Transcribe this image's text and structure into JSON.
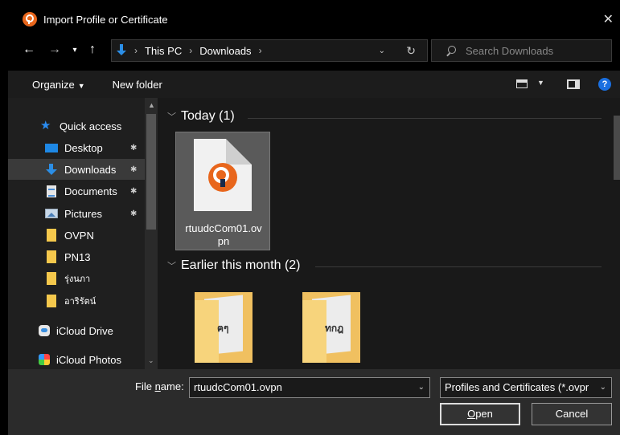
{
  "window": {
    "title": "Import Profile or Certificate",
    "icon": "openvpn-icon",
    "close_glyph": "✕"
  },
  "nav_buttons": {
    "back": "←",
    "forward": "→",
    "recent": "▾",
    "up": "↑"
  },
  "address": {
    "crumbs": [
      "This PC",
      "Downloads"
    ],
    "dropdown": "⌄",
    "refresh": "↻"
  },
  "search": {
    "placeholder": "Search Downloads"
  },
  "toolbar": {
    "organize": "Organize",
    "new_folder": "New folder",
    "help": "?"
  },
  "sidebar": {
    "items": [
      {
        "label": "Quick access",
        "icon": "star-icon"
      },
      {
        "label": "Desktop",
        "icon": "desktop-icon",
        "pinned": true
      },
      {
        "label": "Downloads",
        "icon": "download-icon",
        "pinned": true,
        "selected": true
      },
      {
        "label": "Documents",
        "icon": "documents-icon",
        "pinned": true
      },
      {
        "label": "Pictures",
        "icon": "pictures-icon",
        "pinned": true
      },
      {
        "label": "OVPN",
        "icon": "folder-icon"
      },
      {
        "label": "PN13",
        "icon": "folder-icon"
      },
      {
        "label": "รุ่งนภา",
        "icon": "folder-icon"
      },
      {
        "label": "อาริรัตน์",
        "icon": "folder-icon"
      },
      {
        "label": "iCloud Drive",
        "icon": "icloud-drive-icon"
      },
      {
        "label": "iCloud Photos",
        "icon": "icloud-photos-icon"
      }
    ],
    "pin_glyph": "📌"
  },
  "content": {
    "groups": [
      {
        "header": "Today (1)"
      },
      {
        "header": "Earlier this month (2)"
      }
    ],
    "files": [
      {
        "name": "rtuudcCom01.ovpn",
        "label_line1": "rtuudcCom01.ov",
        "label_line2": "pn",
        "icon": "openvpn-file-icon",
        "selected": true
      }
    ],
    "folders": [
      {
        "mark": "ฅๆ"
      },
      {
        "mark": "ทกฎ"
      }
    ]
  },
  "bottom": {
    "file_name_label_pre": "File ",
    "file_name_label_u": "n",
    "file_name_label_post": "ame:",
    "file_name_value": "rtuudcCom01.ovpn",
    "file_type": "Profiles and Certificates (*.ovpr",
    "open_u": "O",
    "open_rest": "pen",
    "cancel": "Cancel"
  }
}
